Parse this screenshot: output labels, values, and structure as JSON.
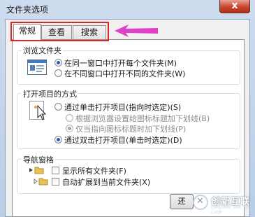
{
  "window": {
    "title": "文件夹选项",
    "close_glyph": "x"
  },
  "tabs": [
    {
      "label": "常规",
      "active": true
    },
    {
      "label": "查看",
      "active": false
    },
    {
      "label": "搜索",
      "active": false
    }
  ],
  "annotation": {
    "highlight_color": "#e0242a",
    "arrow_color": "#e040c8"
  },
  "browse_folders": {
    "title": "浏览文件夹",
    "options": [
      {
        "label": "在同一窗口中打开每个文件夹(M)",
        "selected": true
      },
      {
        "label": "在不同窗口中打开不同的文件夹(W)",
        "selected": false
      }
    ]
  },
  "open_items": {
    "title": "打开项目的方式",
    "single_click": {
      "label": "通过单击打开项目(指向时选定)(S)",
      "selected": false
    },
    "underline_browser": {
      "label": "根据浏览器设置给图标标题加下划线(B)",
      "selected": false,
      "disabled": true
    },
    "underline_hover": {
      "label": "仅当指向图标标题时加下划线(P)",
      "selected": true,
      "disabled": true
    },
    "double_click": {
      "label": "通过双击打开项目(单击时选定)(D)",
      "selected": true
    }
  },
  "nav_pane": {
    "title": "导航窗格",
    "options": [
      {
        "label": "显示所有文件夹(F)",
        "checked": false
      },
      {
        "label": "自动扩展到当前文件夹(X)",
        "checked": false
      }
    ]
  },
  "buttons": {
    "restore_label": "还"
  },
  "watermark": {
    "brand_cn": "创新互联",
    "brand_en": "CHUANG XIN HU LIAN"
  }
}
